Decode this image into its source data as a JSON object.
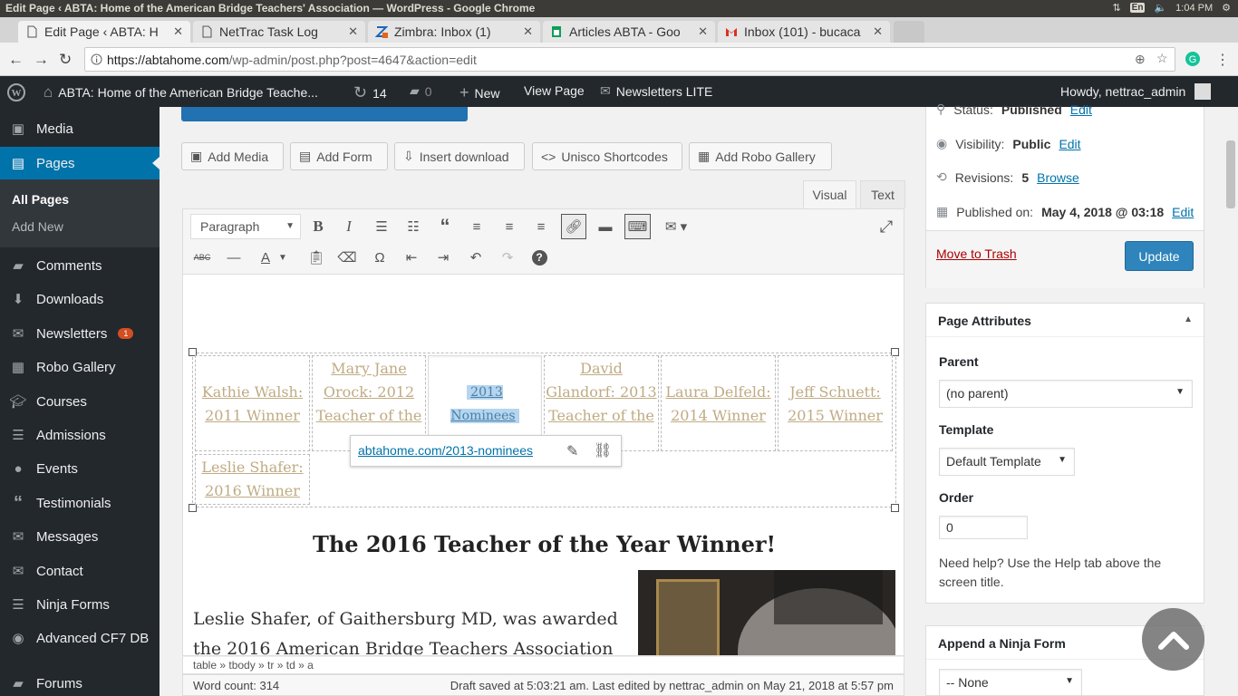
{
  "os_bar": {
    "title": "Edit Page ‹ ABTA: Home of the American Bridge Teachers' Association — WordPress - Google Chrome",
    "lang": "En",
    "time": "1:04 PM"
  },
  "browser": {
    "tabs": [
      {
        "label": "Edit Page ‹ ABTA: H",
        "favicon": "wordpress-favicon"
      },
      {
        "label": "NetTrac Task Log",
        "favicon": "page-favicon"
      },
      {
        "label": "Zimbra: Inbox (1)",
        "favicon": "zimbra-favicon"
      },
      {
        "label": "Articles ABTA - Goo",
        "favicon": "sheets-favicon"
      },
      {
        "label": "Inbox (101) - bucaca",
        "favicon": "gmail-favicon"
      }
    ],
    "url_host": "https://abtahome.com",
    "url_path": "/wp-admin/post.php?post=4647&action=edit"
  },
  "admin_bar": {
    "site_name": "ABTA: Home of the American Bridge Teache...",
    "updates_count": "14",
    "comments_count": "0",
    "new_label": "New",
    "view_page_label": "View Page",
    "newsletters_label": "Newsletters LITE",
    "howdy": "Howdy, nettrac_admin"
  },
  "sidebar": {
    "items": [
      {
        "label": "Media",
        "icon": "media-icon"
      },
      {
        "label": "Pages",
        "icon": "pages-icon"
      },
      {
        "label": "Comments",
        "icon": "comments-icon"
      },
      {
        "label": "Downloads",
        "icon": "downloads-icon"
      },
      {
        "label": "Newsletters",
        "icon": "newsletters-icon",
        "badge": "1"
      },
      {
        "label": "Robo Gallery",
        "icon": "gallery-icon"
      },
      {
        "label": "Courses",
        "icon": "courses-icon"
      },
      {
        "label": "Admissions",
        "icon": "admissions-icon"
      },
      {
        "label": "Events",
        "icon": "events-icon"
      },
      {
        "label": "Testimonials",
        "icon": "quote-icon"
      },
      {
        "label": "Messages",
        "icon": "messages-icon"
      },
      {
        "label": "Contact",
        "icon": "contact-icon"
      },
      {
        "label": "Ninja Forms",
        "icon": "forms-icon"
      },
      {
        "label": "Advanced CF7 DB",
        "icon": "database-icon"
      },
      {
        "label": "Forums",
        "icon": "forums-icon"
      }
    ],
    "submenu": [
      "All Pages",
      "Add New"
    ]
  },
  "editor": {
    "media_buttons": [
      "Add Media",
      "Add Form",
      "Insert download",
      "Unisco Shortcodes",
      "Add Robo Gallery"
    ],
    "tab_visual": "Visual",
    "tab_text": "Text",
    "format_select": "Paragraph",
    "table_cells": [
      {
        "text": "Kathie Walsh: 2011 Winner"
      },
      {
        "text": "Mary Jane Orock: 2012 Teacher of the"
      },
      {
        "text": "2013 Nominees"
      },
      {
        "text": "David Glandorf: 2013 Teacher of the"
      },
      {
        "text": "Laura Delfeld: 2014 Winner"
      },
      {
        "text": "Jeff Schuett: 2015 Winner"
      },
      {
        "text": "Leslie Shafer: 2016 Winner"
      }
    ],
    "link_popup_url": "abtahome.com/2013-nominees",
    "heading": "The 2016 Teacher of the Year Winner!",
    "paragraph": "Leslie Shafer, of Gaithersburg MD, was awarded the 2016 American Bridge Teachers Association (ABTA)",
    "path": "table » tbody » tr » td » a",
    "word_count": "Word count: 314",
    "draft_status": "Draft saved at 5:03:21 am. Last edited by nettrac_admin on May 21, 2018 at 5:57 pm"
  },
  "publish": {
    "status_label": "Status:",
    "status_value": "Published",
    "visibility_label": "Visibility:",
    "visibility_value": "Public",
    "revisions_label": "Revisions:",
    "revisions_value": "5",
    "browse": "Browse",
    "published_label": "Published on:",
    "published_value": "May 4, 2018 @ 03:18",
    "edit": "Edit",
    "trash": "Move to Trash",
    "update": "Update"
  },
  "page_attributes": {
    "title": "Page Attributes",
    "parent_label": "Parent",
    "parent_value": "(no parent)",
    "template_label": "Template",
    "template_value": "Default Template",
    "order_label": "Order",
    "order_value": "0",
    "help": "Need help? Use the Help tab above the screen title."
  },
  "ninja": {
    "title": "Append a Ninja Form",
    "select_value": "-- None"
  },
  "colors": {
    "wp_blue": "#0073aa",
    "admin_dark": "#23282d",
    "link_tan": "#c0ab83"
  }
}
